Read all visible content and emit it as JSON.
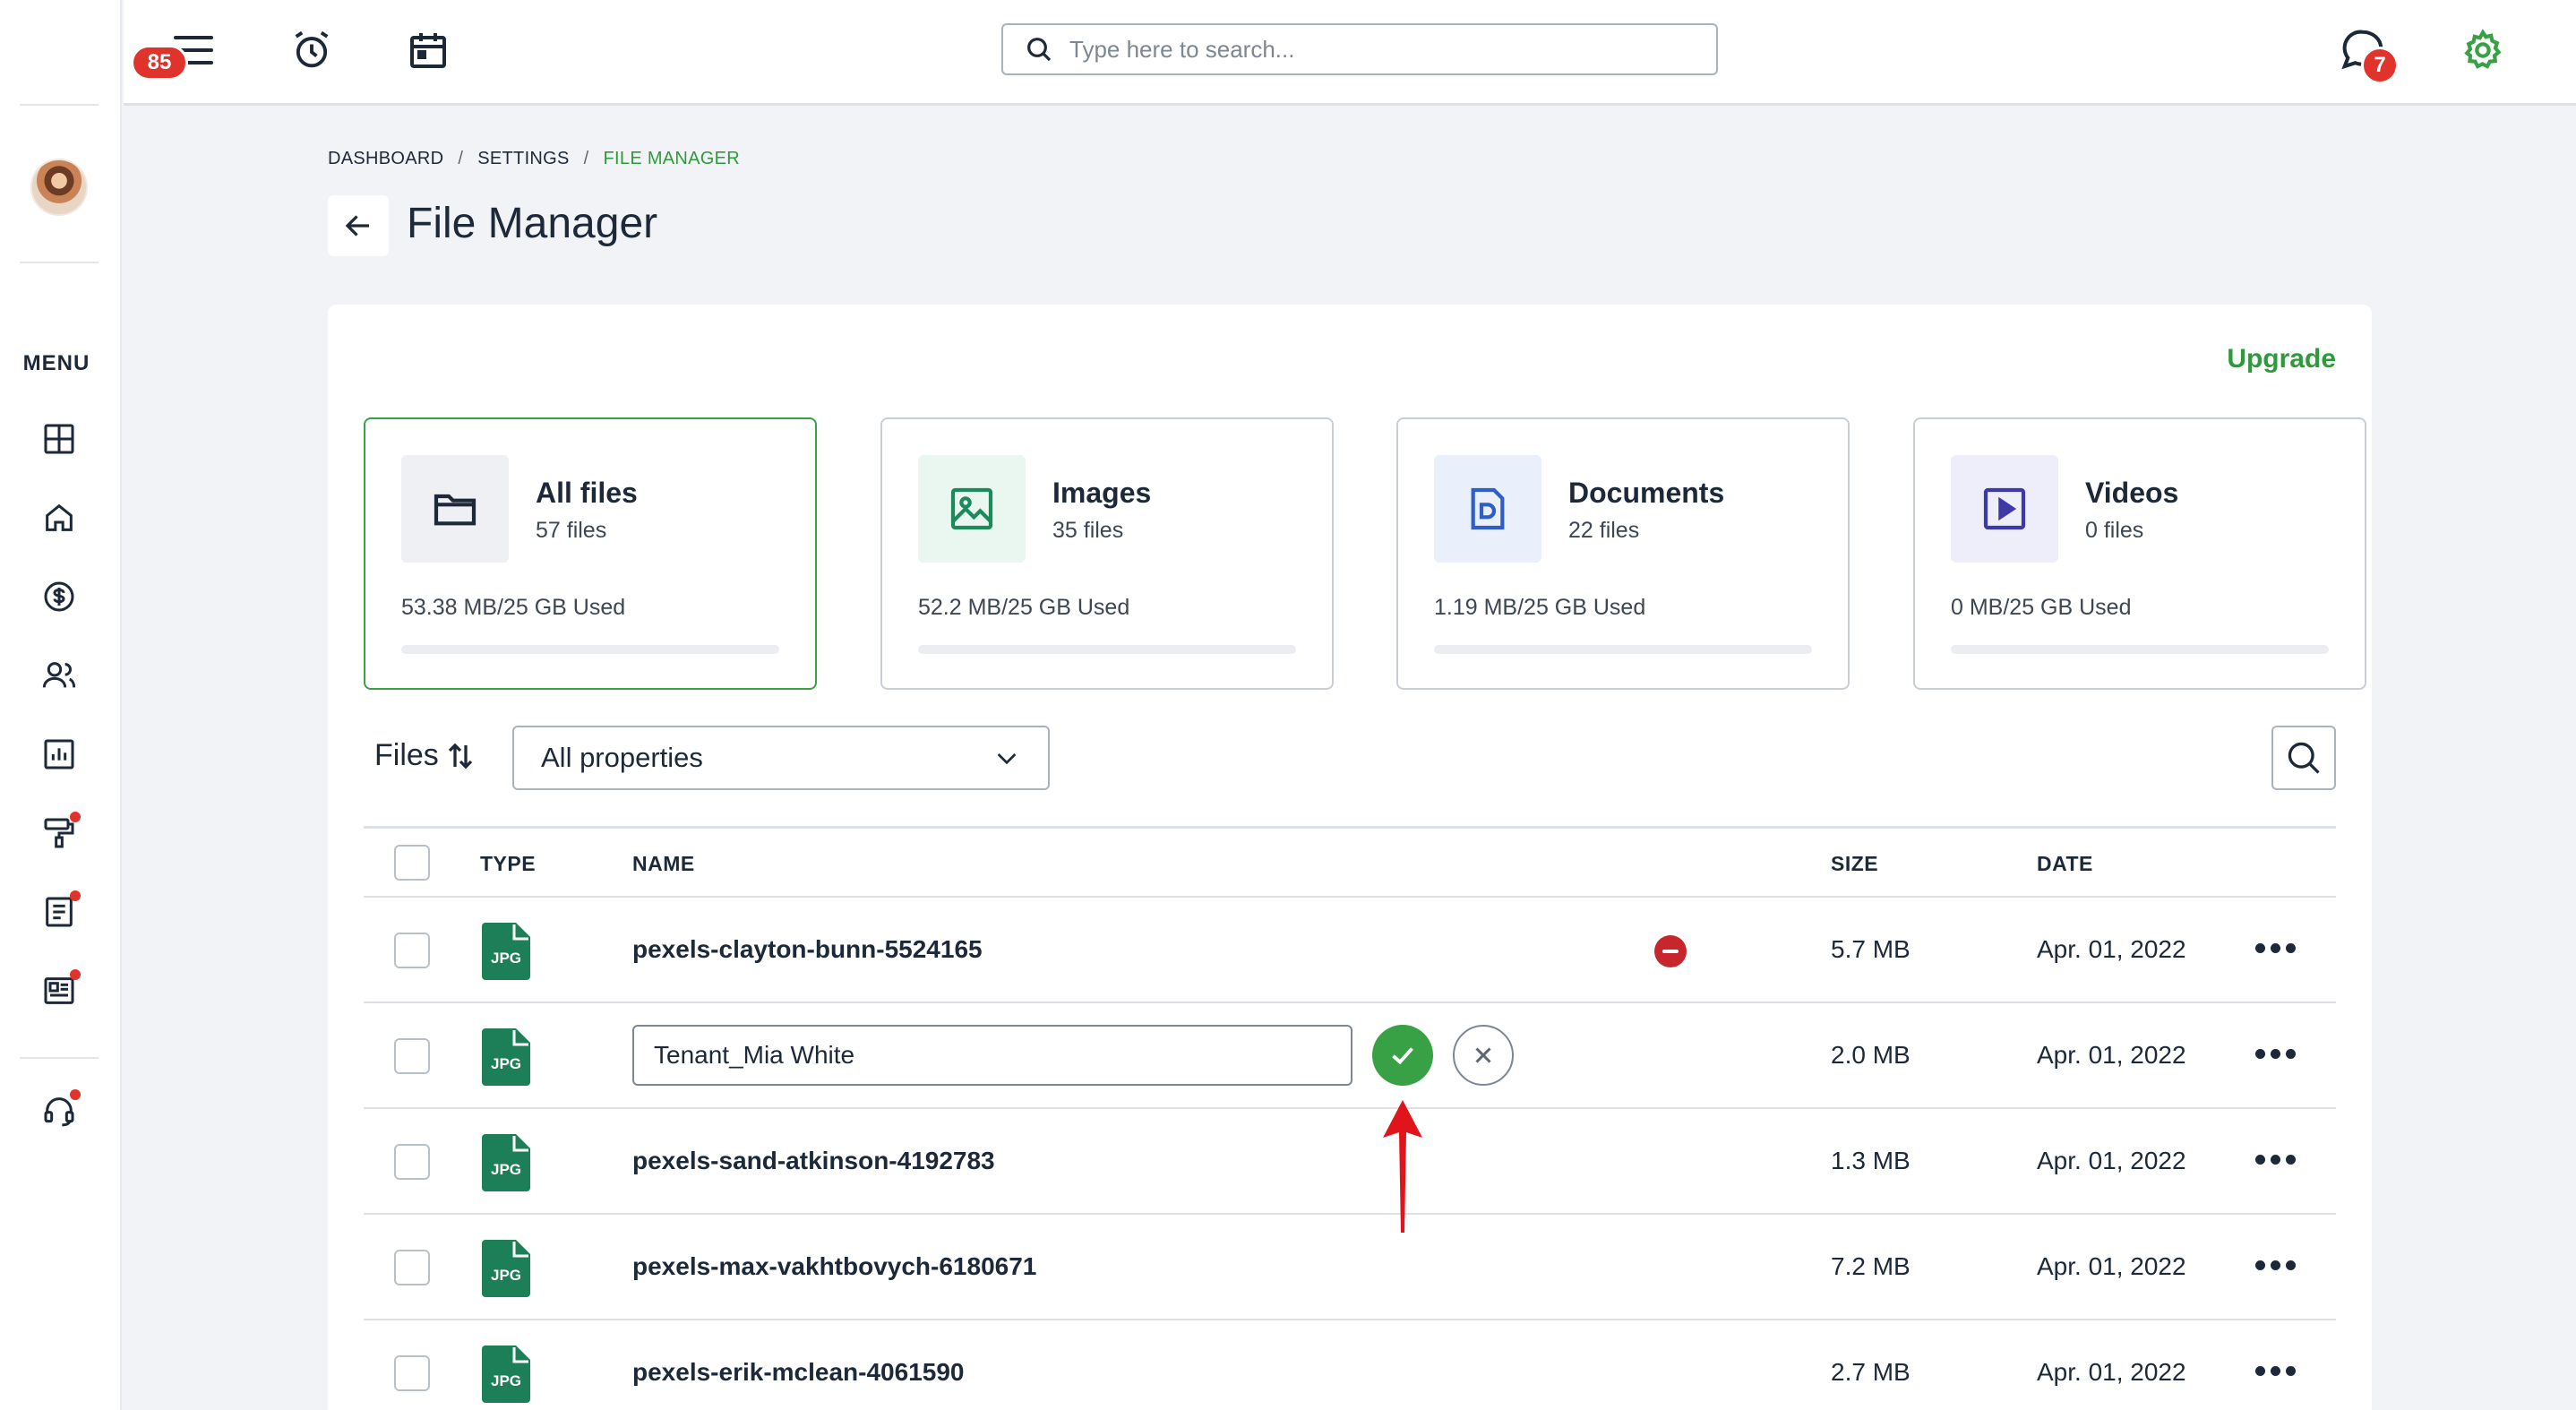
{
  "sidebar": {
    "menu_label": "MENU",
    "items": [
      {
        "icon": "dashboard-icon",
        "dot": false
      },
      {
        "icon": "home-icon",
        "dot": false
      },
      {
        "icon": "dollar-icon",
        "dot": false
      },
      {
        "icon": "users-icon",
        "dot": false
      },
      {
        "icon": "reports-icon",
        "dot": false
      },
      {
        "icon": "paint-roller-icon",
        "dot": true
      },
      {
        "icon": "document-icon",
        "dot": true
      },
      {
        "icon": "newspaper-icon",
        "dot": true
      },
      {
        "icon": "headset-icon",
        "dot": true
      }
    ],
    "notification_dot_color": "#e0332c"
  },
  "header": {
    "alarm_badge": "85",
    "chat_badge": "7",
    "search_placeholder": "Type here to search...",
    "accent_color": "#38a145"
  },
  "breadcrumb": {
    "items": [
      "DASHBOARD",
      "SETTINGS",
      "FILE MANAGER"
    ],
    "separator": "/"
  },
  "page": {
    "title": "File Manager",
    "upgrade_label": "Upgrade"
  },
  "categories": [
    {
      "title": "All files",
      "count": "57 files",
      "usage": "53.38 MB/25 GB Used",
      "icon": "folder-icon",
      "icon_bg": "#eef0f3",
      "icon_color": "#1d2939",
      "selected": true,
      "fill_fraction": 0
    },
    {
      "title": "Images",
      "count": "35 files",
      "usage": "52.2 MB/25 GB Used",
      "icon": "image-icon",
      "icon_bg": "#eaf6f0",
      "icon_color": "#1c8a5a",
      "selected": false,
      "fill_fraction": 0
    },
    {
      "title": "Documents",
      "count": "22 files",
      "usage": "1.19 MB/25 GB Used",
      "icon": "document-icon",
      "icon_bg": "#eaf0fb",
      "icon_color": "#2f5ec4",
      "selected": false,
      "fill_fraction": 0
    },
    {
      "title": "Videos",
      "count": "0 files",
      "usage": "0 MB/25 GB Used",
      "icon": "video-icon",
      "icon_bg": "#eeeefb",
      "icon_color": "#3d3aa8",
      "selected": false,
      "fill_fraction": 0
    }
  ],
  "toolbar": {
    "files_label": "Files",
    "filter_value": "All properties"
  },
  "table": {
    "columns": [
      "TYPE",
      "NAME",
      "SIZE",
      "DATE"
    ],
    "rows": [
      {
        "type": "JPG",
        "name": "pexels-clayton-bunn-5524165",
        "size": "5.7 MB",
        "date": "Apr. 01, 2022",
        "editing": false,
        "remove_badge": true
      },
      {
        "type": "JPG",
        "name": "Tenant_Mia White",
        "size": "2.0 MB",
        "date": "Apr. 01, 2022",
        "editing": true,
        "remove_badge": false
      },
      {
        "type": "JPG",
        "name": "pexels-sand-atkinson-4192783",
        "size": "1.3 MB",
        "date": "Apr. 01, 2022",
        "editing": false,
        "remove_badge": false
      },
      {
        "type": "JPG",
        "name": "pexels-max-vakhtbovych-6180671",
        "size": "7.2 MB",
        "date": "Apr. 01, 2022",
        "editing": false,
        "remove_badge": false
      },
      {
        "type": "JPG",
        "name": "pexels-erik-mclean-4061590",
        "size": "2.7 MB",
        "date": "Apr. 01, 2022",
        "editing": false,
        "remove_badge": false
      }
    ],
    "file_icon_color": "#1c7f57"
  },
  "annotation": {
    "arrow_color": "#e0141b"
  }
}
